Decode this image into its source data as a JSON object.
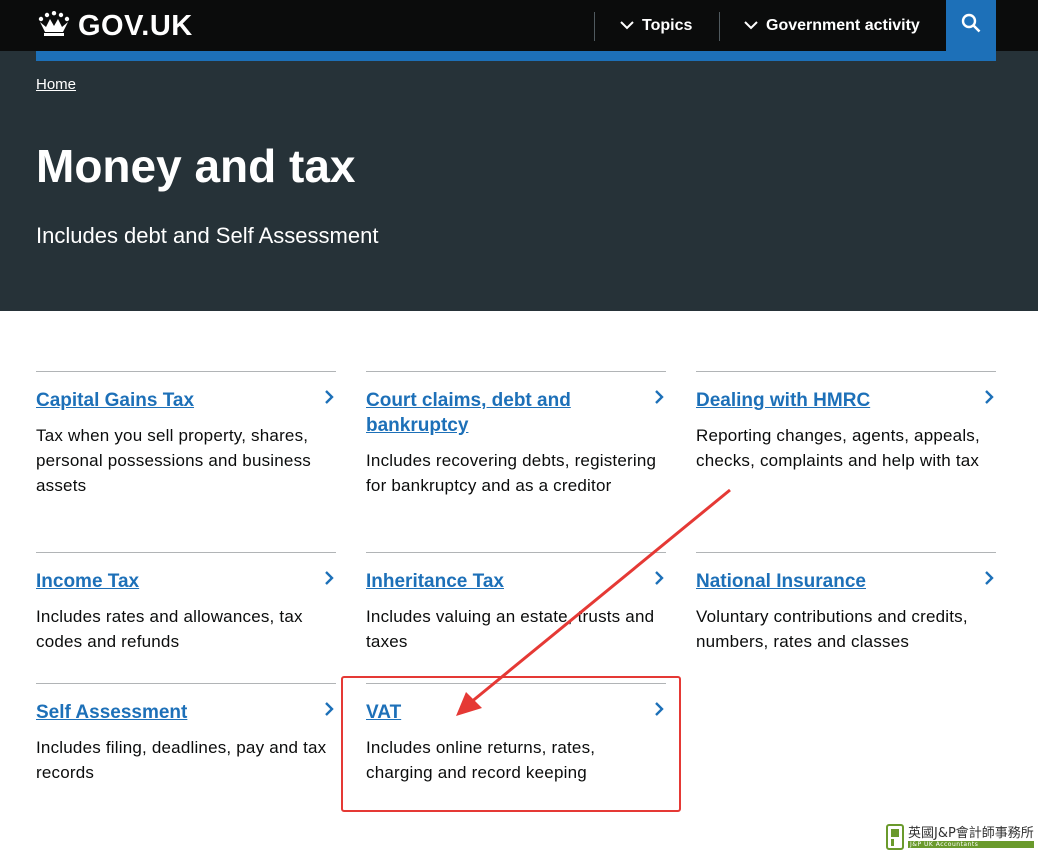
{
  "header": {
    "logo_text": "GOV.UK",
    "nav": [
      {
        "label": "Topics"
      },
      {
        "label": "Government activity"
      }
    ]
  },
  "breadcrumb": {
    "home": "Home"
  },
  "page": {
    "title": "Money and tax",
    "description": "Includes debt and Self Assessment"
  },
  "topics": [
    {
      "title": "Capital Gains Tax",
      "description": "Tax when you sell property, shares, personal possessions and business assets"
    },
    {
      "title": "Court claims, debt and bankruptcy",
      "description": "Includes recovering debts, registering for bankruptcy and as a creditor"
    },
    {
      "title": "Dealing with HMRC",
      "description": "Reporting changes, agents, appeals, checks, complaints and help with tax"
    },
    {
      "title": "Income Tax",
      "description": "Includes rates and allowances, tax codes and refunds"
    },
    {
      "title": "Inheritance Tax",
      "description": "Includes valuing an estate, trusts and taxes"
    },
    {
      "title": "National Insurance",
      "description": "Voluntary contributions and credits, numbers, rates and classes"
    },
    {
      "title": "Self Assessment",
      "description": "Includes filing, deadlines, pay and tax records"
    },
    {
      "title": "VAT",
      "description": "Includes online returns, rates, charging and record keeping"
    }
  ],
  "watermark": {
    "chinese": "英國J&P會計師事務所",
    "english": "J&P UK Accountants"
  },
  "colors": {
    "header_bg": "#0b0c0c",
    "hero_bg": "#263238",
    "link": "#1d70b8",
    "annotation": "#e53935"
  }
}
